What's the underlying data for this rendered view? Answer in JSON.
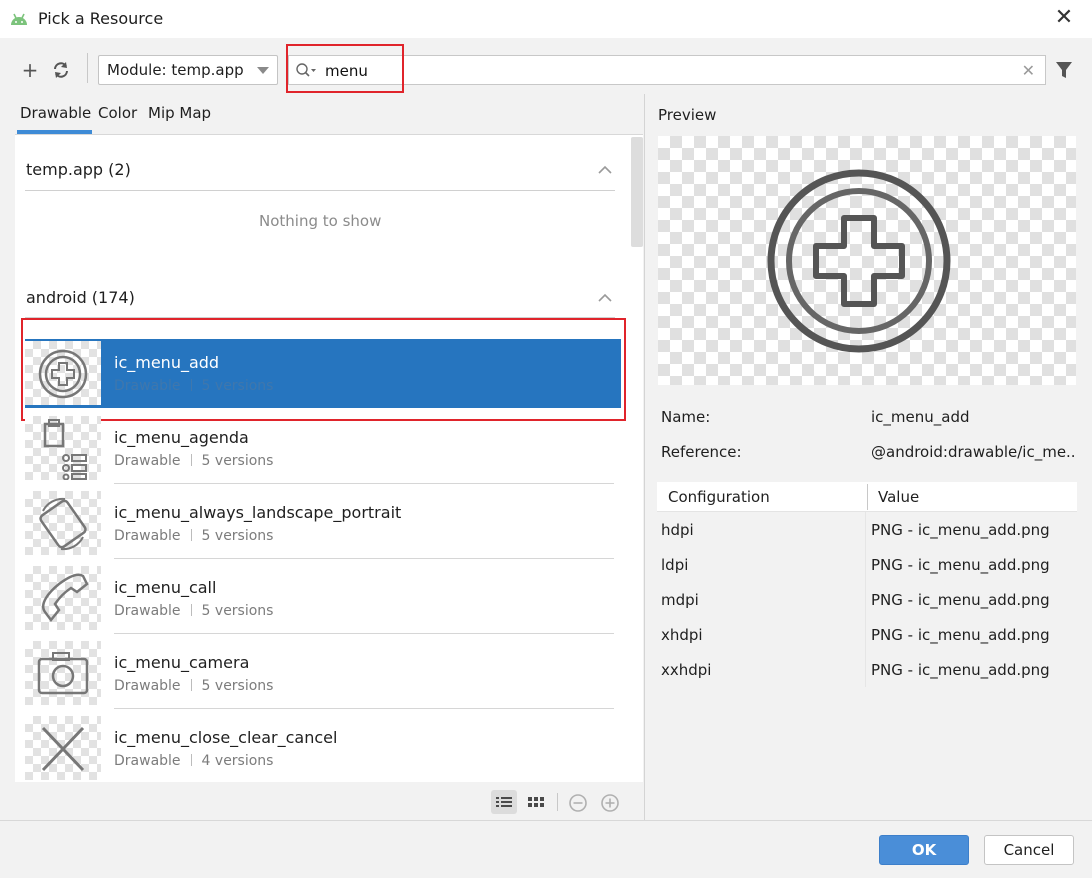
{
  "window": {
    "title": "Pick a Resource"
  },
  "toolbar": {
    "module_label": "Module: temp.app",
    "search_value": "menu"
  },
  "tabs": [
    {
      "label": "Drawable",
      "active": true
    },
    {
      "label": "Color",
      "active": false
    },
    {
      "label": "Mip Map",
      "active": false
    }
  ],
  "sections": [
    {
      "title": "temp.app (2)",
      "empty_text": "Nothing to show"
    },
    {
      "title": "android (174)"
    }
  ],
  "resources": [
    {
      "name": "ic_menu_add",
      "type": "Drawable",
      "versions": "5 versions",
      "icon": "circle-plus-icon",
      "selected": true
    },
    {
      "name": "ic_menu_agenda",
      "type": "Drawable",
      "versions": "5 versions",
      "icon": "agenda-icon",
      "selected": false
    },
    {
      "name": "ic_menu_always_landscape_portrait",
      "type": "Drawable",
      "versions": "5 versions",
      "icon": "rotate-device-icon",
      "selected": false
    },
    {
      "name": "ic_menu_call",
      "type": "Drawable",
      "versions": "5 versions",
      "icon": "phone-icon",
      "selected": false
    },
    {
      "name": "ic_menu_camera",
      "type": "Drawable",
      "versions": "5 versions",
      "icon": "camera-icon",
      "selected": false
    },
    {
      "name": "ic_menu_close_clear_cancel",
      "type": "Drawable",
      "versions": "4 versions",
      "icon": "close-x-icon",
      "selected": false
    }
  ],
  "preview": {
    "label": "Preview",
    "name_label": "Name:",
    "name_value": "ic_menu_add",
    "reference_label": "Reference:",
    "reference_value": "@android:drawable/ic_me..."
  },
  "config_table": {
    "headers": [
      "Configuration",
      "Value"
    ],
    "rows": [
      {
        "config": "hdpi",
        "value": "PNG - ic_menu_add.png"
      },
      {
        "config": "ldpi",
        "value": "PNG - ic_menu_add.png"
      },
      {
        "config": "mdpi",
        "value": "PNG - ic_menu_add.png"
      },
      {
        "config": "xhdpi",
        "value": "PNG - ic_menu_add.png"
      },
      {
        "config": "xxhdpi",
        "value": "PNG - ic_menu_add.png"
      }
    ]
  },
  "footer": {
    "ok_label": "OK",
    "cancel_label": "Cancel"
  },
  "colors": {
    "accent": "#2675bf",
    "ok_button": "#4a8ed8",
    "highlight": "#e0242b"
  }
}
